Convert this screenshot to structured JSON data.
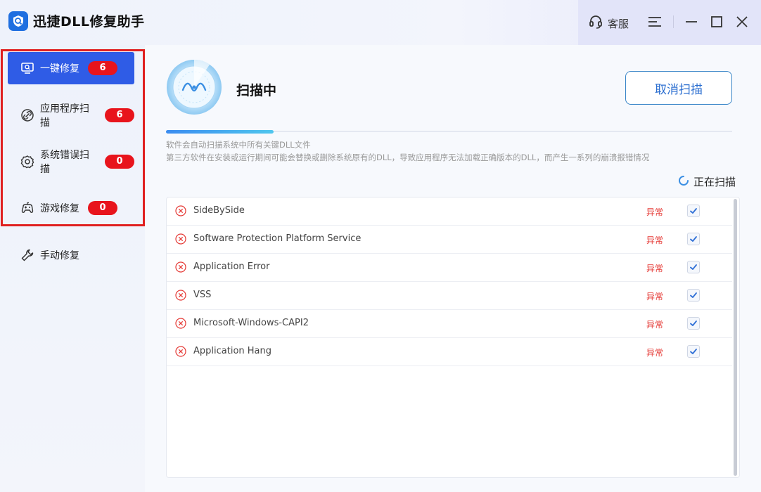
{
  "app": {
    "title": "迅捷DLL修复助手"
  },
  "titlebar": {
    "service_label": "客服"
  },
  "sidebar": {
    "items": [
      {
        "label": "一键修复",
        "badge": "6",
        "icon": "monitor-search-icon",
        "active": true
      },
      {
        "label": "应用程序扫描",
        "badge": "6",
        "icon": "link-icon",
        "active": false
      },
      {
        "label": "系统错误扫描",
        "badge": "0",
        "icon": "gear-icon",
        "active": false
      },
      {
        "label": "游戏修复",
        "badge": "0",
        "icon": "gamepad-icon",
        "active": false
      },
      {
        "label": "手动修复",
        "badge": null,
        "icon": "wrench-icon",
        "active": false
      }
    ]
  },
  "main": {
    "status_title": "扫描中",
    "cancel_button": "取消扫描",
    "progress": 0.19,
    "desc_line1": "软件会自动扫描系统中所有关键DLL文件",
    "desc_line2": "第三方软件在安装或运行期间可能会替换或删除系统原有的DLL，导致应用程序无法加载正确版本的DLL，而产生一系列的崩溃报错情况",
    "scanning_label": "正在扫描",
    "rows": [
      {
        "name": "SideBySide",
        "status": "异常",
        "checked": true
      },
      {
        "name": "Software Protection Platform Service",
        "status": "异常",
        "checked": true
      },
      {
        "name": "Application Error",
        "status": "异常",
        "checked": true
      },
      {
        "name": "VSS",
        "status": "异常",
        "checked": true
      },
      {
        "name": "Microsoft-Windows-CAPI2",
        "status": "异常",
        "checked": true
      },
      {
        "name": "Application Hang",
        "status": "异常",
        "checked": true
      }
    ]
  },
  "colors": {
    "accent": "#2f5ce6",
    "badge": "#e8141c",
    "error": "#e53935",
    "highlight_box": "#e02020"
  }
}
